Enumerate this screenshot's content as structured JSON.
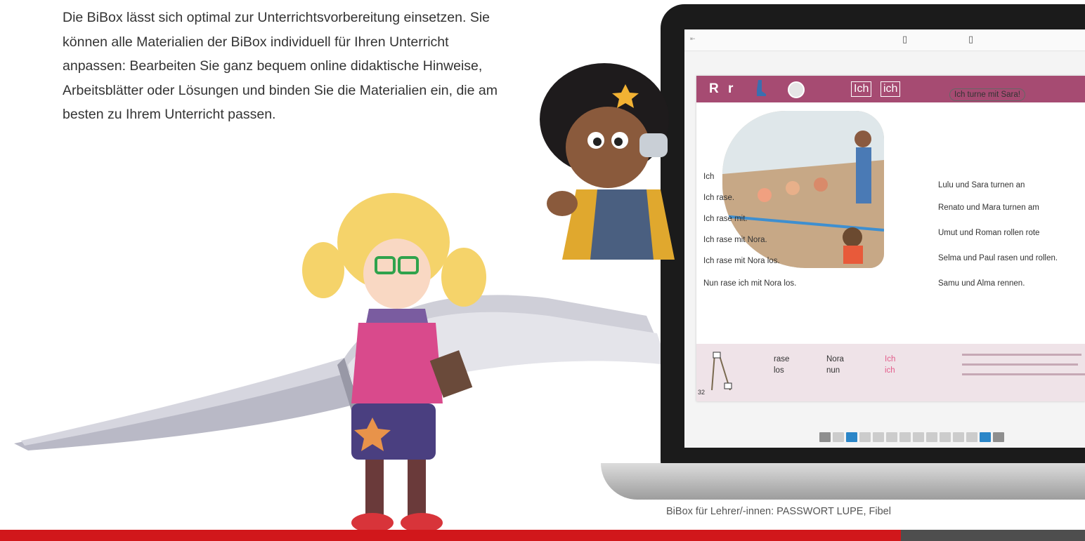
{
  "intro": {
    "text": "Die BiBox lässt sich optimal zur Unterrichtsvorbereitung einsetzen. Sie können alle Materialien der BiBox individuell für Ihren Unterricht anpassen: Bearbeiten Sie ganz bequem online didaktische Hinweise, Arbeitsblätter oder Lösungen und binden Sie die Materialien ein, die am besten zu Ihrem Unterricht passen."
  },
  "caption": "BiBox für Lehrer/-innen: PASSWORT LUPE, Fibel",
  "colors": {
    "accent": "#d1171b",
    "header": "#a64b72",
    "footer_dark": "#4e4e4e"
  },
  "screen": {
    "header": {
      "letters": "R r",
      "ich1": "Ich",
      "ich2": "ich"
    },
    "left_lines": [
      "Ich",
      "Ich rase.",
      "Ich rase mit.",
      "Ich rase mit Nora.",
      "Ich rase mit Nora los.",
      "Nun rase ich mit Nora los."
    ],
    "right_lines": [
      "Ich turne mit Sara!",
      "Lulu und Sara turnen an",
      "Renato und Mara turnen am",
      "Umut und Roman rollen rote",
      "Selma und Paul rasen und rollen.",
      "Samu und Alma rennen."
    ],
    "bottom_words": [
      "rase",
      "los",
      "Nora",
      "nun",
      "Ich",
      "ich"
    ],
    "page_number": "32"
  }
}
